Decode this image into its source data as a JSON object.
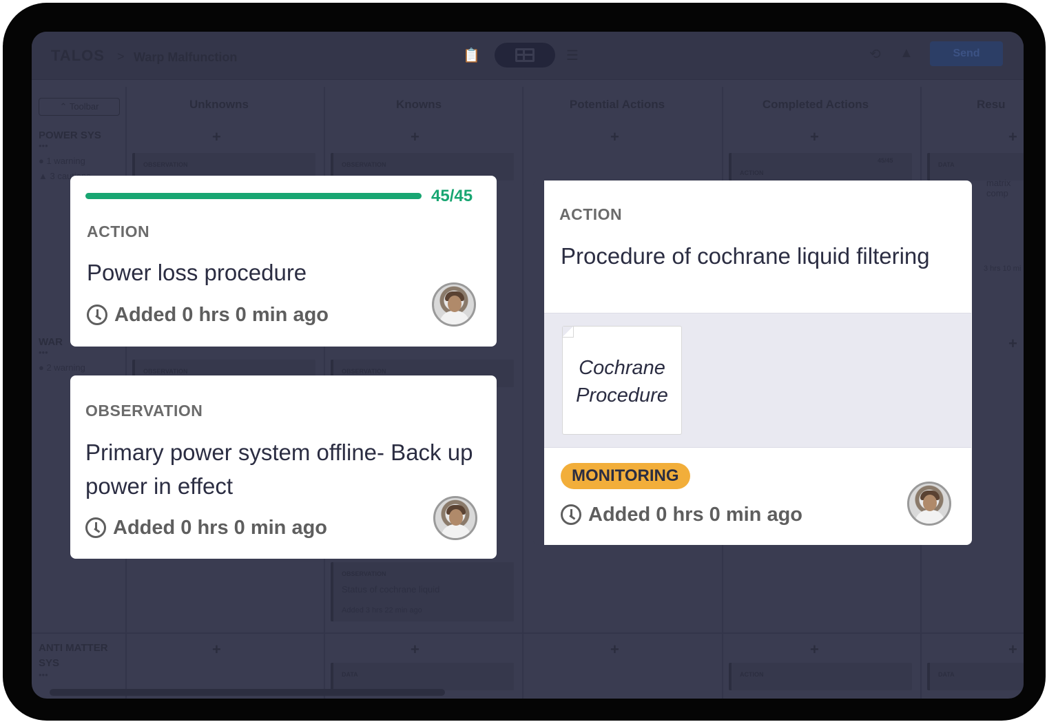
{
  "topbar": {
    "logo": "TALOS",
    "breadcrumb_sep": ">",
    "breadcrumb": "Warp Malfunction",
    "send_label": "Send",
    "icons": [
      "clipboard-icon",
      "grid-view-icon",
      "list-view-icon",
      "history-icon",
      "bell-icon"
    ]
  },
  "board": {
    "toolbar_label": "Toolbar",
    "columns": [
      "Unknowns",
      "Knowns",
      "Potential Actions",
      "Completed Actions",
      "Resu"
    ],
    "rows": [
      {
        "label": "POWER SYS",
        "dots": "•••",
        "warning": "1 warning",
        "caution": "3 cautions"
      },
      {
        "label": "WAR",
        "dots": "•••",
        "warning": "2 warning"
      },
      {
        "label": "ANTI MATTER SYS",
        "dots": "•••"
      }
    ],
    "bg_tags": {
      "observation": "OBSERVATION",
      "action": "ACTION",
      "data": "DATA"
    },
    "bg_progress": "45/45",
    "bg_snippets": {
      "data_text": "matrix comp",
      "data_time": "3 hrs 10 mi",
      "observation_text": "Status of cochrane liquid",
      "observation_time": "Added 3 hrs 22 min ago"
    }
  },
  "cards": {
    "power_loss": {
      "progress_text": "45/45",
      "progress_fraction": 1.0,
      "label": "ACTION",
      "title": "Power loss procedure",
      "meta": "Added 0 hrs 0 min ago"
    },
    "primary_power": {
      "label": "OBSERVATION",
      "title": "Primary power system offline- Back up power in effect",
      "meta": "Added 0 hrs 0 min ago"
    },
    "cochrane": {
      "label": "ACTION",
      "title": "Procedure of cochrane liquid filtering",
      "attachment": "Cochrane Procedure",
      "status": "MONITORING",
      "meta": "Added 0 hrs 0 min ago"
    }
  },
  "colors": {
    "progress": "#18a672",
    "monitoring": "#f2ae3a",
    "overlay": "#3a3c51"
  }
}
